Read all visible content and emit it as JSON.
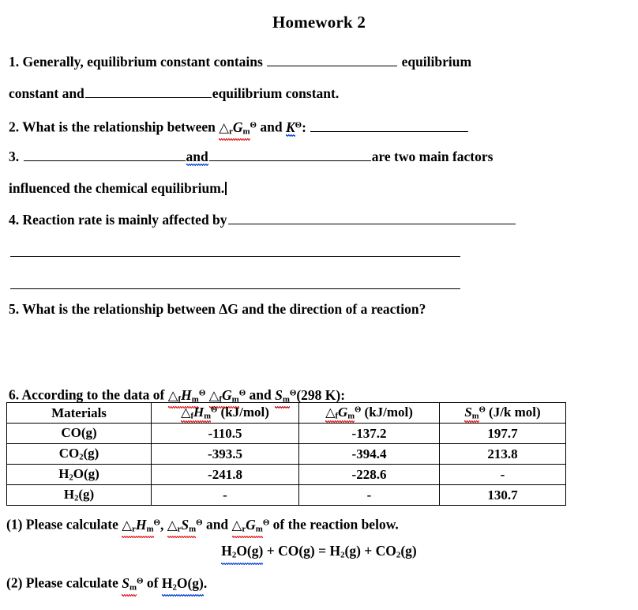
{
  "document": {
    "title": "Homework 2"
  },
  "questions": {
    "q1": {
      "part_a": "1.  Generally,  equilibrium  constant  contains",
      "part_b": "equilibrium",
      "part_c": "constant and",
      "part_d": "equilibrium constant."
    },
    "q2": {
      "lead": "2. What is the relationship between",
      "sym_delta_r_gm": "△rGm",
      "and": "and",
      "sym_k": "K",
      "theta": "Θ",
      "colon": ":"
    },
    "q3": {
      "number": "3.",
      "and": "and",
      "tail": "are  two  main  factors",
      "line2": "influenced the chemical equilibrium."
    },
    "q4": {
      "text": "4. Reaction rate is mainly affected by"
    },
    "q5": {
      "text": "5. What is the relationship between ΔG and the direction of a reaction?"
    },
    "q6": {
      "lead": "6. According to the data of",
      "sym_fhm": "△fHm",
      "sym_fgm": "△fGm",
      "and": "and",
      "sym_sm": "Sm",
      "temperature": "(298 K):",
      "theta": "Θ"
    },
    "q6_part1": {
      "prefix": "(1) Please calculate",
      "sym_rhm": "△rHm",
      "sym_rsm": "△rSm",
      "and": "and",
      "sym_rgm": "△rGm",
      "suffix": "of the reaction below.",
      "comma": ",",
      "theta": "Θ"
    },
    "equation": {
      "text": "H2O(g) + CO(g) = H2(g) + CO2(g)",
      "left_reactant_1": "H",
      "left_reactant_1_sub": "2",
      "left_reactant_1_rest": "O(g)",
      "plus": "+",
      "left_reactant_2": "CO(g)",
      "equals": "=",
      "right_product_1": "H",
      "right_product_1_sub": "2",
      "right_product_1_rest": "(g)",
      "right_product_2": "CO",
      "right_product_2_sub": "2",
      "right_product_2_rest": "(g)"
    },
    "q6_part2": {
      "prefix": "(2) Please calculate",
      "sym_sm": "Sm",
      "of": "of",
      "species": "H2O(g).",
      "theta": "Θ"
    }
  },
  "table": {
    "headers": {
      "materials": "Materials",
      "enthalpy": "△fHm",
      "enthalpy_units": "(kJ/mol)",
      "gibbs": "△fGm",
      "gibbs_units": "(kJ/mol)",
      "entropy": "Sm",
      "entropy_units": "(J/k mol)",
      "theta": "Θ"
    },
    "rows": [
      {
        "material": "CO",
        "material_sub": "",
        "material_state": "(g)",
        "enthalpy": "-110.5",
        "gibbs": "-137.2",
        "entropy": "197.7"
      },
      {
        "material": "CO",
        "material_sub": "2",
        "material_state": "(g)",
        "enthalpy": "-393.5",
        "gibbs": "-394.4",
        "entropy": "213.8"
      },
      {
        "material": "H",
        "material_sub": "2",
        "material_state": "O(g)",
        "enthalpy": "-241.8",
        "gibbs": "-228.6",
        "entropy": "-"
      },
      {
        "material": "H",
        "material_sub": "2",
        "material_state": "(g)",
        "enthalpy": "-",
        "gibbs": "-",
        "entropy": "130.7"
      }
    ]
  },
  "colors": {
    "text": "#000000",
    "spellcheck_red": "#e02020",
    "spellcheck_blue": "#2255dd",
    "page_background": "#ffffff"
  }
}
